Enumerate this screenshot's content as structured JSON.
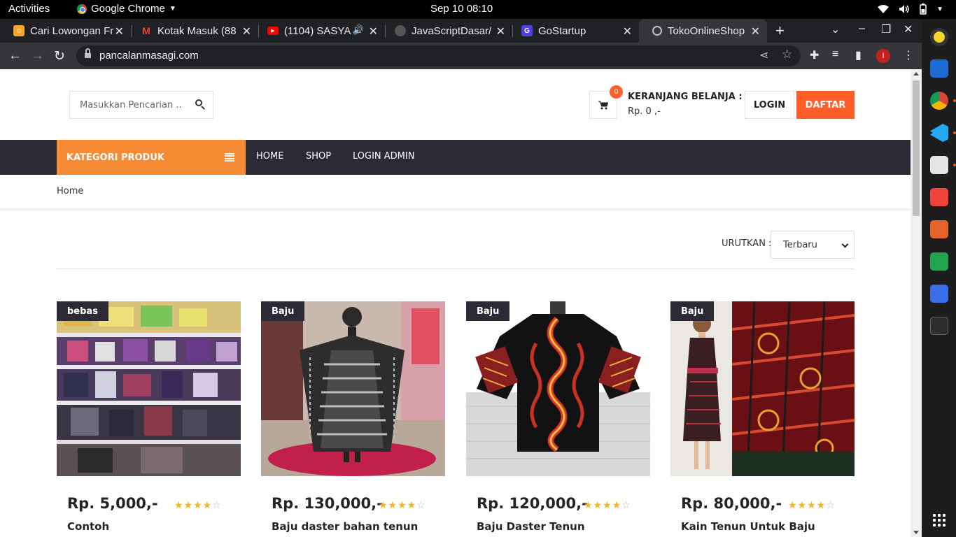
{
  "topbar": {
    "activities": "Activities",
    "app_name": "Google Chrome",
    "clock": "Sep 10  08:10"
  },
  "tabs": [
    {
      "title": "Cari Lowongan Fr",
      "favicon": "job-icon",
      "color": "#f5a623"
    },
    {
      "title": "Kotak Masuk (88",
      "favicon": "gmail-icon",
      "color": "#ea4335"
    },
    {
      "title": "(1104) SASYA",
      "favicon": "youtube-icon",
      "color": "#ff0000"
    },
    {
      "title": "JavaScriptDasar/",
      "favicon": "github-icon",
      "color": "#333333"
    },
    {
      "title": "GoStartup",
      "favicon": "gostartup-icon",
      "color": "#4b3fe0"
    },
    {
      "title": "TokoOnlineShop",
      "favicon": "globe-icon",
      "color": "#bdc1c6",
      "active": true
    }
  ],
  "toolbar": {
    "url": "pancalanmasagi.com",
    "profile_initial": "I"
  },
  "header": {
    "search_placeholder": "Masukkan Pencarian ..",
    "cart_count": "0",
    "cart_title": "KERANJANG BELANJA :",
    "cart_total": "Rp. 0 ,-",
    "login_label": "LOGIN",
    "daftar_label": "DAFTAR"
  },
  "nav": {
    "kategori_label": "KATEGORI PRODUK",
    "links": [
      "HOME",
      "SHOP",
      "LOGIN ADMIN"
    ]
  },
  "breadcrumb": "Home",
  "sort": {
    "label": "URUTKAN :",
    "selected": "Terbaru"
  },
  "products": [
    {
      "category": "bebas",
      "price": "Rp. 5,000,-",
      "name": "Contoh",
      "rating": 4
    },
    {
      "category": "Baju",
      "price": "Rp. 130,000,-",
      "name": "Baju daster bahan tenun",
      "rating": 4
    },
    {
      "category": "Baju",
      "price": "Rp. 120,000,-",
      "name": "Baju Daster Tenun",
      "rating": 4
    },
    {
      "category": "Baju",
      "price": "Rp. 80,000,-",
      "name": "Kain Tenun Untuk Baju",
      "rating": 4
    }
  ],
  "colors": {
    "accent_orange": "#fe5f2a",
    "kategori_orange": "#f68b34",
    "nav_dark": "#2b2a35"
  }
}
